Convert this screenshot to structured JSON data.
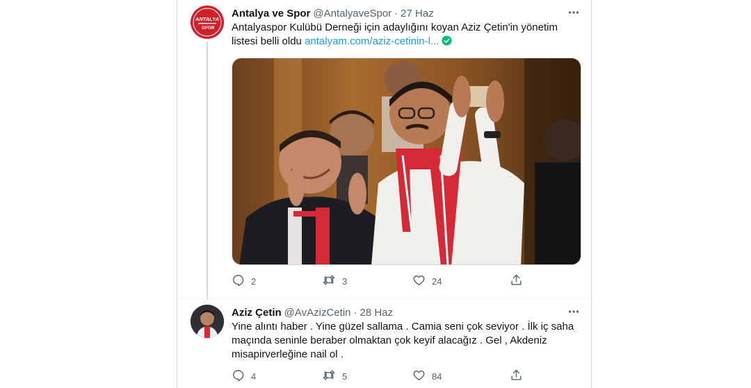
{
  "tweets": [
    {
      "display_name": "Antalya ve Spor",
      "handle": "@AntalyaveSpor",
      "date": "27 Haz",
      "avatar_text": "ANTALYA SPOR",
      "text_main": "Antalyaspor Kulübü Derneği için adaylığını koyan Aziz Çetin'in yönetim listesi belli oldu ",
      "link_text": "antalyam.com/aziz-cetinin-l...",
      "replies": "2",
      "retweets": "3",
      "likes": "24",
      "has_photo": true
    },
    {
      "display_name": "Aziz Çetin",
      "handle": "@AvAzizCetin",
      "date": "28 Haz",
      "text_main": "Yine alıntı haber . Yine güzel sallama . Camia seni çok seviyor . İlk iç saha maçında seninle beraber olmaktan çok keyif alacağız . Gel , Akdeniz misapirverleğine nail ol .",
      "replies": "4",
      "retweets": "5",
      "likes": "84"
    }
  ],
  "icons": {
    "more": "more-horizontal-icon",
    "reply": "reply-icon",
    "retweet": "retweet-icon",
    "like": "heart-icon",
    "share": "share-icon",
    "verified": "verified-check-icon"
  },
  "colors": {
    "link": "#1d9bf0",
    "secondary_text": "#536471",
    "brand_red": "#d0202a",
    "verified_green": "#00ba7c"
  }
}
